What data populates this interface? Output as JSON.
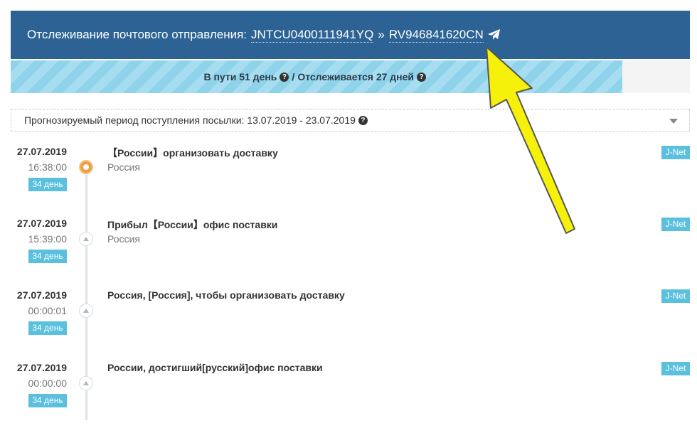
{
  "header": {
    "title": "Отслеживание почтового отправления:",
    "track_primary": "JNTCU0400111941YQ",
    "separator": "»",
    "track_secondary": "RV946841620CN",
    "icon": "paper-plane-icon"
  },
  "progress": {
    "text_in_transit": "В пути 51 день",
    "separator": "/",
    "text_tracked": "Отслеживается 27 дней",
    "fill_fraction": 0.9,
    "help_icon": "question-circle-icon"
  },
  "forecast": {
    "text": "Прогнозируемый период поступления посылки: 13.07.2019 - 23.07.2019",
    "help_icon": "question-circle-icon",
    "expand_icon": "chevron-down-icon"
  },
  "events": [
    {
      "date": "27.07.2019",
      "time": "16:38:00",
      "day": "34 день",
      "status": "【России】организовать доставку",
      "location": "Россия",
      "carrier": "J-Net",
      "active": true
    },
    {
      "date": "27.07.2019",
      "time": "15:39:00",
      "day": "34 день",
      "status": "Прибыл【России】офис поставки",
      "location": "Россия",
      "carrier": "J-Net",
      "active": false
    },
    {
      "date": "27.07.2019",
      "time": "00:00:01",
      "day": "34 день",
      "status": "Россия, [Россия], чтобы организовать доставку",
      "location": "",
      "carrier": "J-Net",
      "active": false
    },
    {
      "date": "27.07.2019",
      "time": "00:00:00",
      "day": "34 день",
      "status": "России, достигший[русский]офис поставки",
      "location": "",
      "carrier": "J-Net",
      "active": false
    }
  ],
  "colors": {
    "header_bg": "#2d6394",
    "progress_stripe": "#8ed3ea",
    "badge": "#5bc0de",
    "annotation_arrow": "#f5f10a"
  }
}
